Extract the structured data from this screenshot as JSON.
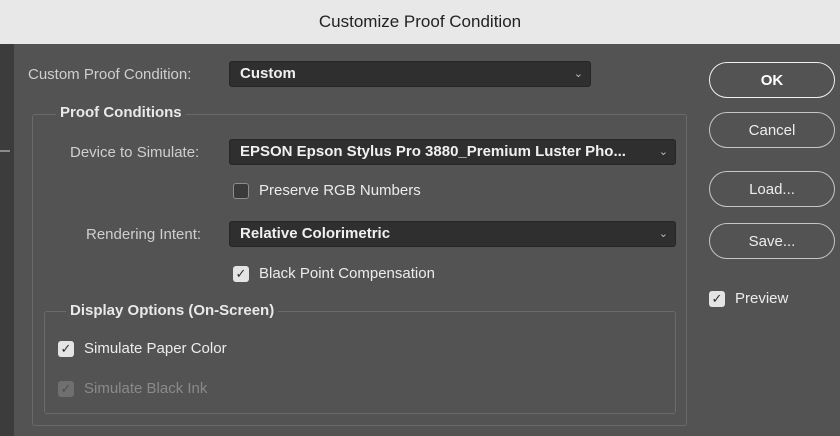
{
  "window": {
    "title": "Customize Proof Condition"
  },
  "custom_condition": {
    "label": "Custom Proof Condition:",
    "value": "Custom"
  },
  "proof_conditions": {
    "heading": "Proof Conditions",
    "device_label": "Device to Simulate:",
    "device_value": "EPSON Epson Stylus Pro 3880_Premium Luster Pho...",
    "preserve_rgb": {
      "label": "Preserve RGB Numbers",
      "checked": false
    },
    "intent_label": "Rendering Intent:",
    "intent_value": "Relative Colorimetric",
    "black_point": {
      "label": "Black Point Compensation",
      "checked": true
    }
  },
  "display_options": {
    "heading": "Display Options (On-Screen)",
    "paper_color": {
      "label": "Simulate Paper Color",
      "checked": true
    },
    "black_ink": {
      "label": "Simulate Black Ink",
      "checked": true,
      "disabled": true
    }
  },
  "buttons": {
    "ok": "OK",
    "cancel": "Cancel",
    "load": "Load...",
    "save": "Save..."
  },
  "preview": {
    "label": "Preview",
    "checked": true
  },
  "icons": {
    "check": "✓",
    "chevron": "⌄"
  }
}
